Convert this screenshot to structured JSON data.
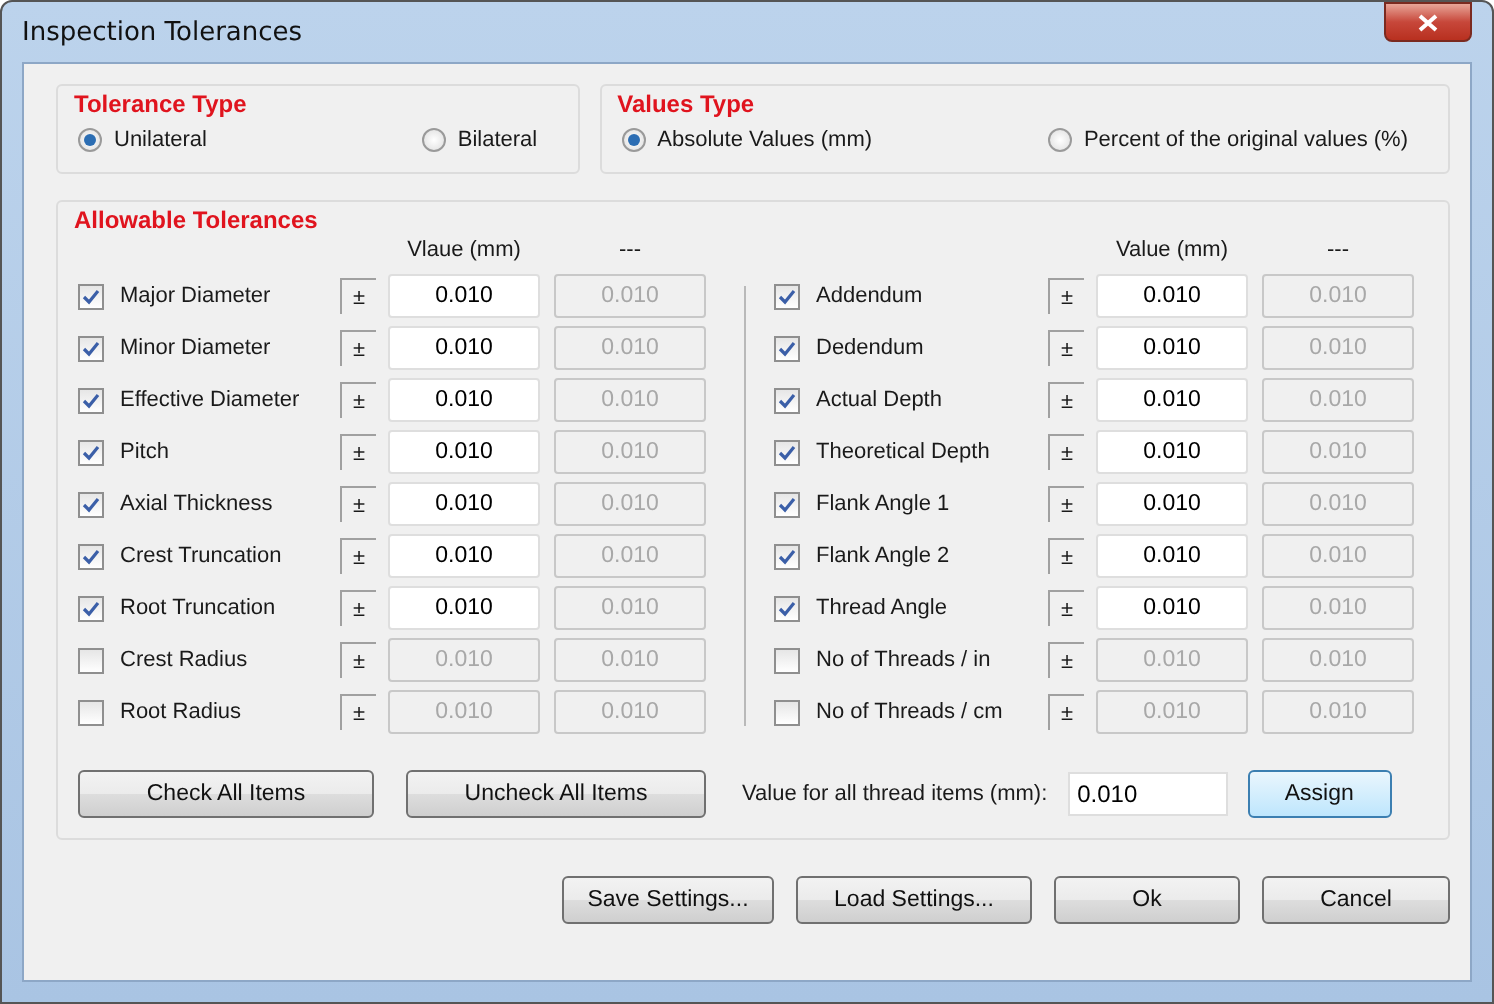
{
  "window": {
    "title": "Inspection Tolerances"
  },
  "tolerance_type": {
    "title": "Tolerance Type",
    "options": [
      {
        "label": "Unilateral",
        "selected": true
      },
      {
        "label": "Bilateral",
        "selected": false
      }
    ]
  },
  "values_type": {
    "title": "Values Type",
    "options": [
      {
        "label": "Absolute Values (mm)",
        "selected": true
      },
      {
        "label": "Percent of the original values (%)",
        "selected": false
      }
    ]
  },
  "allowable": {
    "title": "Allowable Tolerances",
    "columns": [
      {
        "value_header": "Vlaue (mm)",
        "extra_header": "---",
        "rows": [
          {
            "label": "Major Diameter",
            "checked": true,
            "sign": "±",
            "value": "0.010",
            "extra": "0.010"
          },
          {
            "label": "Minor Diameter",
            "checked": true,
            "sign": "±",
            "value": "0.010",
            "extra": "0.010"
          },
          {
            "label": "Effective Diameter",
            "checked": true,
            "sign": "±",
            "value": "0.010",
            "extra": "0.010"
          },
          {
            "label": "Pitch",
            "checked": true,
            "sign": "±",
            "value": "0.010",
            "extra": "0.010"
          },
          {
            "label": "Axial Thickness",
            "checked": true,
            "sign": "±",
            "value": "0.010",
            "extra": "0.010"
          },
          {
            "label": "Crest Truncation",
            "checked": true,
            "sign": "±",
            "value": "0.010",
            "extra": "0.010"
          },
          {
            "label": "Root Truncation",
            "checked": true,
            "sign": "±",
            "value": "0.010",
            "extra": "0.010"
          },
          {
            "label": "Crest Radius",
            "checked": false,
            "sign": "±",
            "value": "0.010",
            "extra": "0.010"
          },
          {
            "label": "Root Radius",
            "checked": false,
            "sign": "±",
            "value": "0.010",
            "extra": "0.010"
          }
        ]
      },
      {
        "value_header": "Value (mm)",
        "extra_header": "---",
        "rows": [
          {
            "label": "Addendum",
            "checked": true,
            "sign": "±",
            "value": "0.010",
            "extra": "0.010"
          },
          {
            "label": "Dedendum",
            "checked": true,
            "sign": "±",
            "value": "0.010",
            "extra": "0.010"
          },
          {
            "label": "Actual Depth",
            "checked": true,
            "sign": "±",
            "value": "0.010",
            "extra": "0.010"
          },
          {
            "label": "Theoretical Depth",
            "checked": true,
            "sign": "±",
            "value": "0.010",
            "extra": "0.010"
          },
          {
            "label": "Flank Angle 1",
            "checked": true,
            "sign": "±",
            "value": "0.010",
            "extra": "0.010"
          },
          {
            "label": "Flank Angle 2",
            "checked": true,
            "sign": "±",
            "value": "0.010",
            "extra": "0.010"
          },
          {
            "label": "Thread Angle",
            "checked": true,
            "sign": "±",
            "value": "0.010",
            "extra": "0.010"
          },
          {
            "label": "No of Threads / in",
            "checked": false,
            "sign": "±",
            "value": "0.010",
            "extra": "0.010"
          },
          {
            "label": "No of Threads / cm",
            "checked": false,
            "sign": "±",
            "value": "0.010",
            "extra": "0.010"
          }
        ]
      }
    ],
    "check_all": "Check All Items",
    "uncheck_all": "Uncheck All Items",
    "all_value_label": "Value for all thread items (mm):",
    "all_value": "0.010",
    "assign": "Assign"
  },
  "buttons": [
    "Save Settings...",
    "Load Settings...",
    "Ok",
    "Cancel"
  ]
}
